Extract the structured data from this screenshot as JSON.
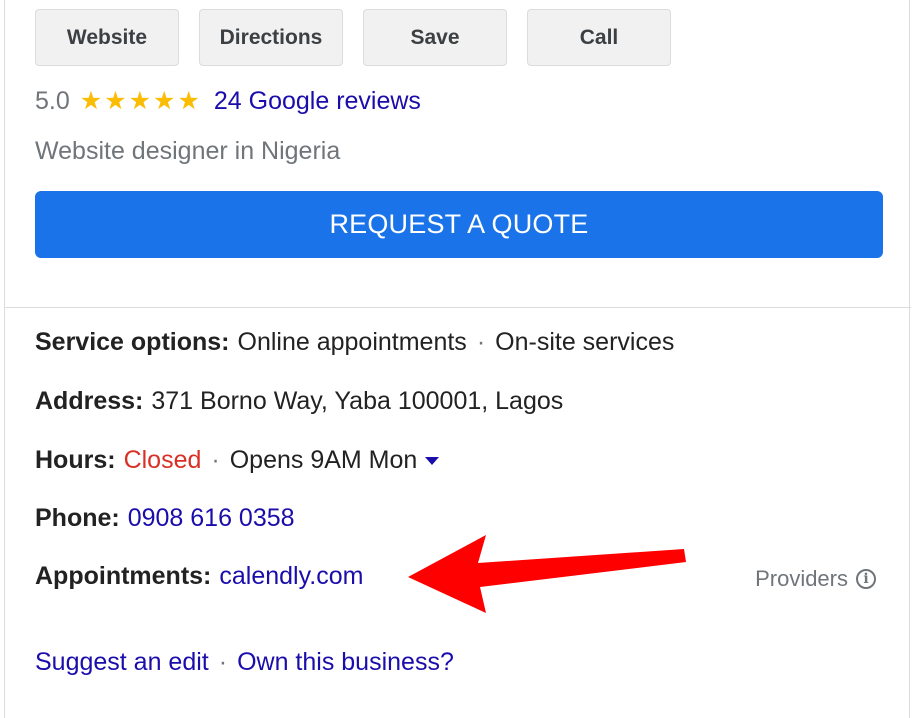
{
  "actions": {
    "website_label": "Website",
    "directions_label": "Directions",
    "save_label": "Save",
    "call_label": "Call"
  },
  "rating": {
    "value": "5.0",
    "stars": 5,
    "reviews_link": "24 Google reviews"
  },
  "category": "Website designer in Nigeria",
  "quote_button": "REQUEST A QUOTE",
  "service_options": {
    "label": "Service options:",
    "option_1": "Online appointments",
    "separator": "·",
    "option_2": "On-site services"
  },
  "address": {
    "label": "Address:",
    "value": "371 Borno Way, Yaba 100001, Lagos"
  },
  "hours": {
    "label": "Hours:",
    "status": "Closed",
    "separator": "·",
    "next_open": "Opens 9AM Mon"
  },
  "phone": {
    "label": "Phone:",
    "value": "0908 616 0358"
  },
  "appointments": {
    "label": "Appointments:",
    "value": "calendly.com",
    "providers_label": "Providers"
  },
  "footer": {
    "suggest_edit": "Suggest an edit",
    "separator": "·",
    "own_business": "Own this business?"
  },
  "colors": {
    "accent_blue": "#1a73e8",
    "link_blue": "#1a0dab",
    "closed_red": "#d93025",
    "star_yellow": "#fbbc04",
    "annotation_arrow": "#ff0000"
  },
  "icons": {
    "star": "star-icon",
    "dropdown": "caret-down-icon",
    "info": "info-icon",
    "annotation": "red-arrow-annotation"
  }
}
